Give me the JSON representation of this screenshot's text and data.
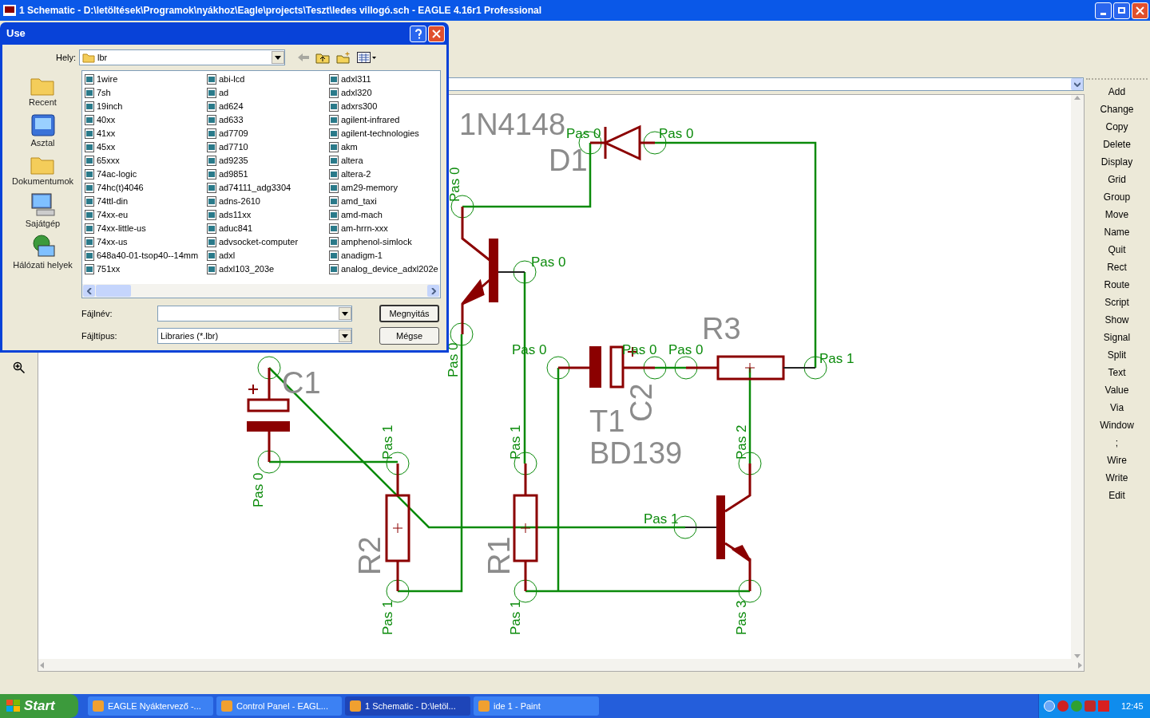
{
  "window": {
    "title": "1 Schematic - D:\\letöltések\\Programok\\nyákhoz\\Eagle\\projects\\Teszt\\ledes villogó.sch - EAGLE 4.16r1 Professional"
  },
  "command_panel": {
    "commands": [
      "Add",
      "Change",
      "Copy",
      "Delete",
      "Display",
      "Grid",
      "Group",
      "Move",
      "Name",
      "Quit",
      "Rect",
      "Route",
      "Script",
      "Show",
      "Signal",
      "Split",
      "Text",
      "Value",
      "Via",
      "Window",
      ";",
      "Wire",
      "Write",
      "Edit"
    ]
  },
  "schematic": {
    "part_labels": [
      "1N4148",
      "D1",
      "R3",
      "C1",
      "T1",
      "C2",
      "BD139",
      "R2",
      "R1"
    ],
    "pin_labels": [
      "Pas 0",
      "Pas 0",
      "Pas 0",
      "Pas 0",
      "Pas 0",
      "Pas 0",
      "Pas 1",
      "Pas 1",
      "Pas 0",
      "Pas 0",
      "Pas 0",
      "Pas 1",
      "Pas 1",
      "Pas 1",
      "Pas 1",
      "Pas 2",
      "Pas 3"
    ]
  },
  "dialog": {
    "title": "Use",
    "location_label": "Hely:",
    "location": "lbr",
    "places": [
      "Recent",
      "Asztal",
      "Dokumentumok",
      "Sajátgép",
      "Hálózati helyek"
    ],
    "files": [
      "1wire",
      "7sh",
      "19inch",
      "40xx",
      "41xx",
      "45xx",
      "65xxx",
      "74ac-logic",
      "74hc(t)4046",
      "74ttl-din",
      "74xx-eu",
      "74xx-little-us",
      "74xx-us",
      "648a40-01-tsop40--14mm",
      "751xx",
      "abi-lcd",
      "ad",
      "ad624",
      "ad633",
      "ad7709",
      "ad7710",
      "ad9235",
      "ad9851",
      "ad74111_adg3304",
      "adns-2610",
      "ads11xx",
      "aduc841",
      "advsocket-computer",
      "adxl",
      "adxl103_203e",
      "adxl311",
      "adxl320",
      "adxrs300",
      "agilent-infrared",
      "agilent-technologies",
      "akm",
      "altera",
      "altera-2",
      "am29-memory",
      "amd_taxi",
      "amd-mach",
      "am-hrrn-xxx",
      "amphenol-simlock",
      "anadigm-1",
      "analog_device_adxl202e"
    ],
    "filename_label": "Fájlnév:",
    "filetype_label": "Fájltípus:",
    "filetype": "Libraries (*.lbr)",
    "buttons": [
      "Megnyitás",
      "Mégse"
    ]
  },
  "taskbar": {
    "start": "Start",
    "tasks": [
      {
        "label": "EAGLE Nyáktervező -...",
        "selected": false
      },
      {
        "label": "Control Panel - EAGL...",
        "selected": false
      },
      {
        "label": "1 Schematic - D:\\letöl...",
        "selected": true
      },
      {
        "label": "ide 1 - Paint",
        "selected": false
      }
    ],
    "clock": "12:45"
  }
}
